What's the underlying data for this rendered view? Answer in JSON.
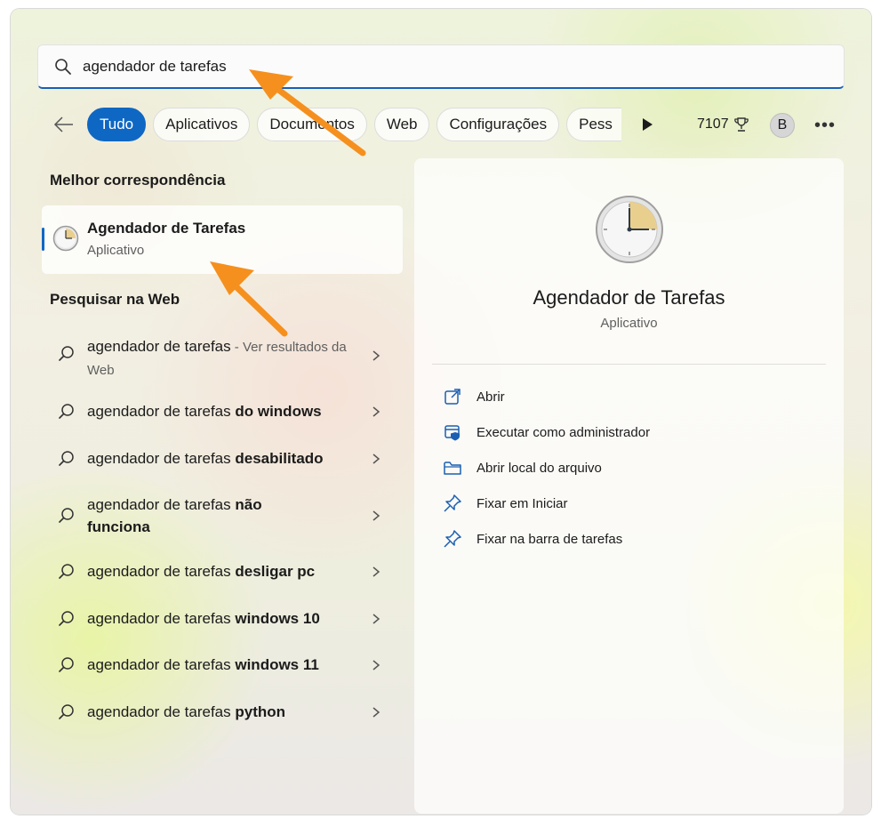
{
  "search": {
    "query": "agendador de tarefas"
  },
  "filters": {
    "chips": [
      "Tudo",
      "Aplicativos",
      "Documentos",
      "Web",
      "Configurações",
      "Pess"
    ],
    "points": "7107",
    "avatar": "B"
  },
  "best_match": {
    "title": "Melhor correspondência",
    "name": "Agendador de Tarefas",
    "type": "Aplicativo"
  },
  "web": {
    "title": "Pesquisar na Web",
    "items": [
      {
        "prefix": "agendador de tarefas",
        "bold": "",
        "suffix": " - Ver resultados da Web"
      },
      {
        "prefix": "agendador de tarefas ",
        "bold": "do windows",
        "suffix": ""
      },
      {
        "prefix": "agendador de tarefas ",
        "bold": "desabilitado",
        "suffix": ""
      },
      {
        "prefix": "agendador de tarefas ",
        "bold": "não funciona",
        "suffix": ""
      },
      {
        "prefix": "agendador de tarefas ",
        "bold": "desligar pc",
        "suffix": ""
      },
      {
        "prefix": "agendador de tarefas ",
        "bold": "windows 10",
        "suffix": ""
      },
      {
        "prefix": "agendador de tarefas ",
        "bold": "windows 11",
        "suffix": ""
      },
      {
        "prefix": "agendador de tarefas ",
        "bold": "python",
        "suffix": ""
      }
    ]
  },
  "detail": {
    "name": "Agendador de Tarefas",
    "type": "Aplicativo",
    "actions": [
      {
        "label": "Abrir",
        "icon": "open-external-icon"
      },
      {
        "label": "Executar como administrador",
        "icon": "shield-admin-icon"
      },
      {
        "label": "Abrir local do arquivo",
        "icon": "folder-icon"
      },
      {
        "label": "Fixar em Iniciar",
        "icon": "pin-icon"
      },
      {
        "label": "Fixar na barra de tarefas",
        "icon": "pin-icon"
      }
    ]
  },
  "colors": {
    "accent": "#0f67c4",
    "annotation": "#f5901e"
  }
}
